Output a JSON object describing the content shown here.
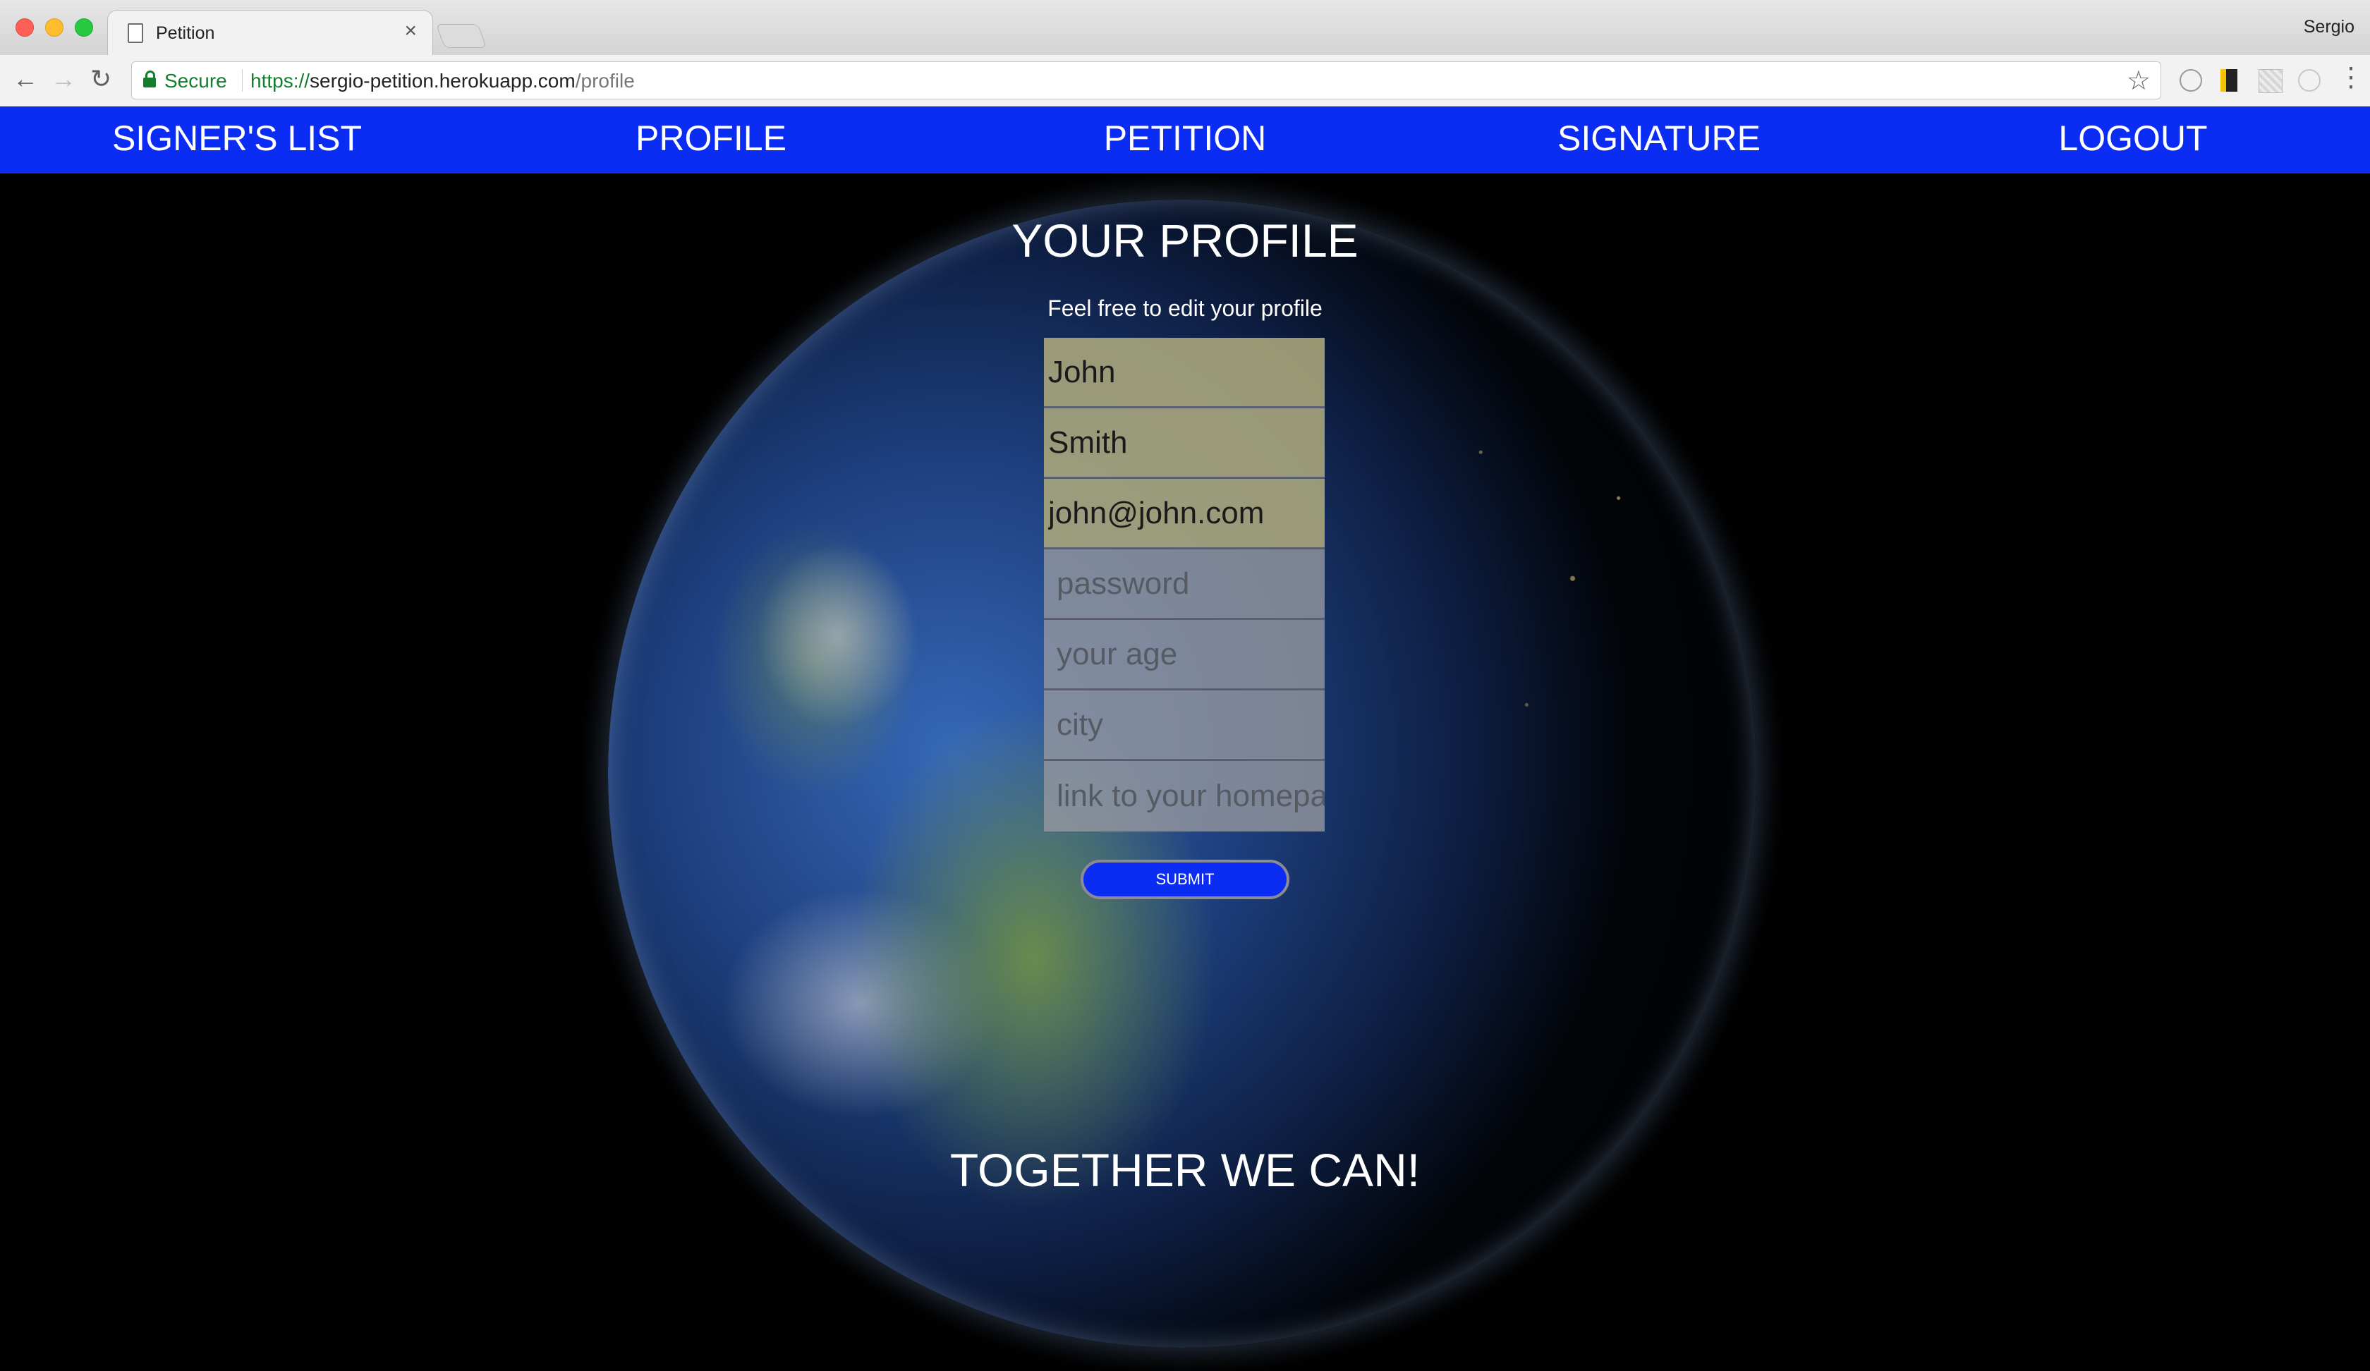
{
  "browser": {
    "tab_title": "Petition",
    "tab_close": "×",
    "profile_name": "Sergio",
    "secure_label": "Secure",
    "url_scheme": "https://",
    "url_host": "sergio-petition.herokuapp.com",
    "url_path": "/profile",
    "nav_back_glyph": "←",
    "nav_forward_glyph": "→",
    "nav_reload_glyph": "↻",
    "bookmark_glyph": "☆",
    "menu_glyph": "⋮"
  },
  "site_nav": {
    "items": [
      {
        "label": "SIGNER'S LIST"
      },
      {
        "label": "PROFILE"
      },
      {
        "label": "PETITION"
      },
      {
        "label": "SIGNATURE"
      },
      {
        "label": "LOGOUT"
      }
    ]
  },
  "profile": {
    "title": "YOUR PROFILE",
    "subtitle": "Feel free to edit your profile",
    "fields": {
      "first_name": {
        "value": "John",
        "placeholder": ""
      },
      "last_name": {
        "value": "Smith",
        "placeholder": ""
      },
      "email": {
        "value": "john@john.com",
        "placeholder": ""
      },
      "password": {
        "value": "",
        "placeholder": "password"
      },
      "age": {
        "value": "",
        "placeholder": "your age"
      },
      "city": {
        "value": "",
        "placeholder": "city"
      },
      "homepage": {
        "value": "",
        "placeholder": "link to your homepa"
      }
    },
    "submit_label": "SUBMIT"
  },
  "footer": {
    "slogan": "TOGETHER WE CAN!"
  },
  "colors": {
    "nav_bg": "#0b2cf2",
    "page_bg": "#000000",
    "submit_bg": "#0b2cf2",
    "secure_green": "#137f2e"
  }
}
